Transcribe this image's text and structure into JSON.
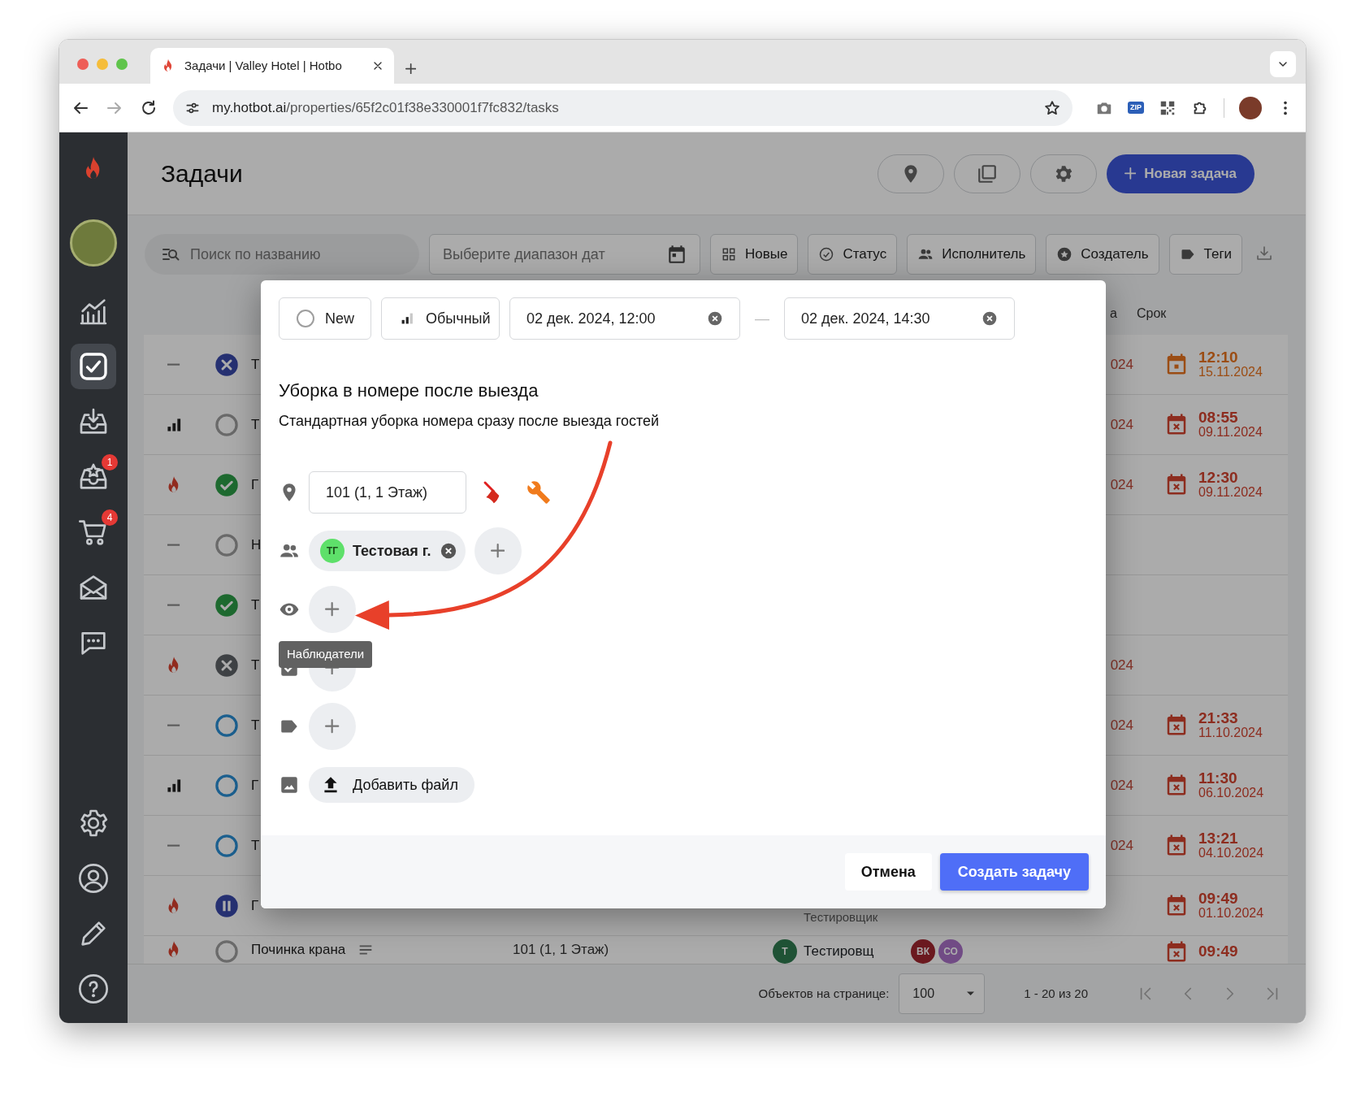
{
  "browser": {
    "tab_title": "Задачи | Valley Hotel | Hotbo",
    "url_host": "my.hotbot.ai",
    "url_path": "/properties/65f2c01f38e330001f7fc832/tasks",
    "extension_badge": "ZIP"
  },
  "sidebar": {
    "items": [
      {
        "kind": "analytics",
        "selected": false
      },
      {
        "kind": "tasks",
        "selected": true
      },
      {
        "kind": "inbox",
        "selected": false
      },
      {
        "kind": "inbox-star",
        "selected": false,
        "badge": "1"
      },
      {
        "kind": "cart",
        "selected": false,
        "badge": "4"
      },
      {
        "kind": "mail",
        "selected": false
      },
      {
        "kind": "chat",
        "selected": false
      }
    ],
    "bottom_items": [
      {
        "kind": "settings",
        "selected": false
      },
      {
        "kind": "user",
        "selected": false
      },
      {
        "kind": "edit",
        "selected": false
      },
      {
        "kind": "help",
        "selected": false
      }
    ]
  },
  "header": {
    "title": "Задачи",
    "actions": [
      {
        "kind": "pin"
      },
      {
        "kind": "copy"
      },
      {
        "kind": "settings"
      }
    ],
    "new_task": "Новая задача"
  },
  "filters": {
    "search_placeholder": "Поиск по названию",
    "date_placeholder": "Выберите диапазон дат",
    "chips": [
      {
        "kind": "grid",
        "label": "Новые"
      },
      {
        "kind": "status",
        "label": "Статус"
      },
      {
        "kind": "people",
        "label": "Исполнитель"
      },
      {
        "kind": "creator",
        "label": "Создатель"
      },
      {
        "kind": "tag",
        "label": "Теги"
      }
    ]
  },
  "table": {
    "column_3_heading": "а",
    "deadline_heading": "Срок",
    "rows": [
      {
        "priority": {
          "kind": "none"
        },
        "status": {
          "kind": "cancelled"
        },
        "title": "Т",
        "column_3": "024",
        "deadline": {
          "time": "12:10",
          "date": "15.11.2024",
          "overdue": false
        }
      },
      {
        "priority": {
          "kind": "medium"
        },
        "status": {
          "kind": "new"
        },
        "title": "Т",
        "column_3": "024",
        "deadline": {
          "time": "08:55",
          "date": "09.11.2024",
          "overdue": true
        }
      },
      {
        "priority": {
          "kind": "high"
        },
        "status": {
          "kind": "done"
        },
        "title": "Г",
        "column_3": "024",
        "deadline": {
          "time": "12:30",
          "date": "09.11.2024",
          "overdue": true
        }
      },
      {
        "priority": {
          "kind": "none"
        },
        "status": {
          "kind": "new"
        },
        "title": "Н"
      },
      {
        "priority": {
          "kind": "none"
        },
        "status": {
          "kind": "done"
        },
        "title": "Т"
      },
      {
        "priority": {
          "kind": "high"
        },
        "status": {
          "kind": "rejected"
        },
        "title": "Т",
        "column_3": "024"
      },
      {
        "priority": {
          "kind": "none"
        },
        "status": {
          "kind": "open"
        },
        "title": "Т",
        "column_3": "024",
        "deadline": {
          "time": "21:33",
          "date": "11.10.2024",
          "overdue": true
        }
      },
      {
        "priority": {
          "kind": "medium"
        },
        "status": {
          "kind": "open"
        },
        "title": "Г",
        "column_3": "024",
        "deadline": {
          "time": "11:30",
          "date": "06.10.2024",
          "overdue": true
        }
      },
      {
        "priority": {
          "kind": "none"
        },
        "status": {
          "kind": "open"
        },
        "title": "Т",
        "column_3": "024",
        "deadline": {
          "time": "13:21",
          "date": "04.10.2024",
          "overdue": true
        }
      },
      {
        "priority": {
          "kind": "high"
        },
        "status": {
          "kind": "paused"
        },
        "title": "Г",
        "executor_role": "Тестировщик",
        "deadline": {
          "time": "09:49",
          "date": "01.10.2024",
          "overdue": true
        }
      },
      {
        "priority": {
          "kind": "high"
        },
        "status": {
          "kind": "new"
        },
        "title": "Починка крана",
        "has_description": true,
        "room": "101 (1, 1 Этаж)",
        "executor": {
          "initials": "Т",
          "name": "Тестировщ",
          "color": "#1f5235"
        },
        "watchers": [
          {
            "initials": "ВК",
            "color": "#6b191f"
          },
          {
            "initials": "СО",
            "color": "#714b85"
          }
        ],
        "deadline": {
          "time": "09:49",
          "overdue": true
        }
      }
    ]
  },
  "pagination": {
    "per_page_label": "Объектов на странице:",
    "per_page": "100",
    "range": "1 - 20 из 20"
  },
  "modal": {
    "status": {
      "kind": "new",
      "label": "New"
    },
    "priority": {
      "kind": "medium",
      "label": "Обычный"
    },
    "start": "02 дек. 2024, 12:00",
    "range_separator": "—",
    "end": "02 дек. 2024, 14:30",
    "title": "Уборка в номере после выезда",
    "description": "Стандартная уборка номера сразу после выезда гостей",
    "location": "101 (1, 1 Этаж)",
    "assignees": [
      {
        "initials": "ТГ",
        "name": "Тестовая г.",
        "color": "#5ee06a"
      }
    ],
    "tooltip": "Наблюдатели",
    "attach_label": "Добавить файл",
    "cancel": "Отмена",
    "submit": "Создать задачу"
  }
}
